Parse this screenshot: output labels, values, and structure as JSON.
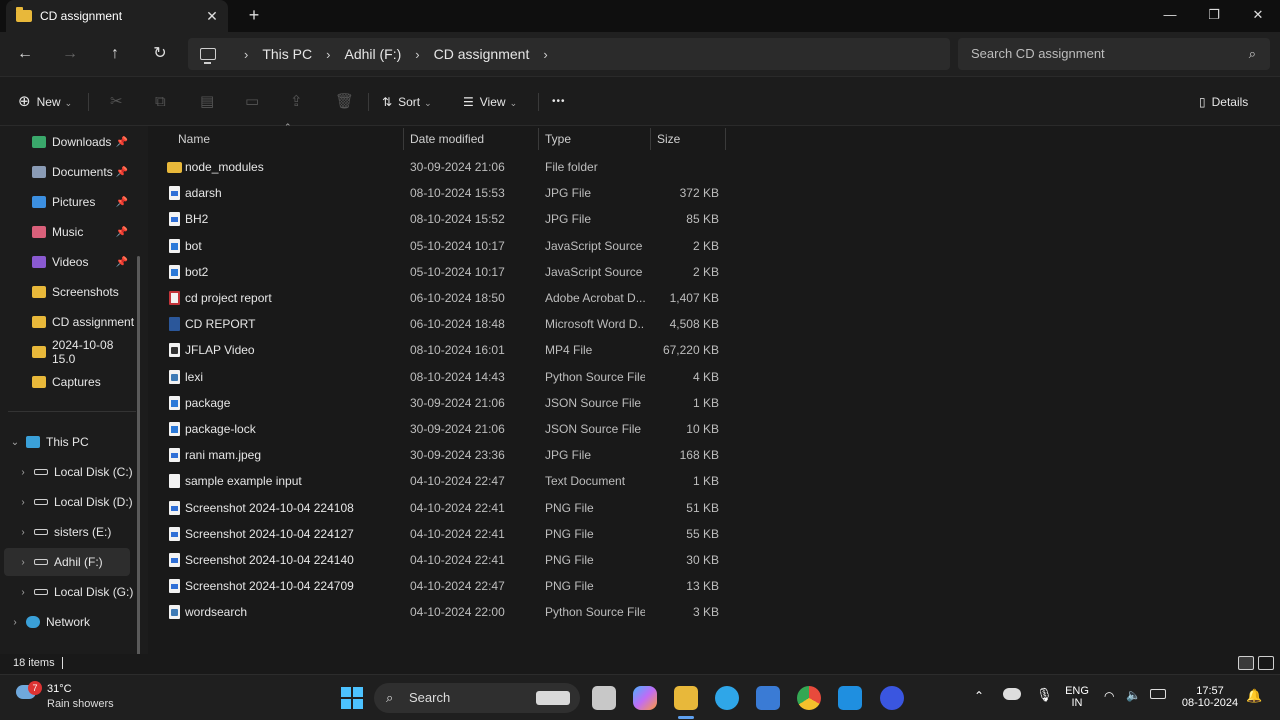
{
  "window": {
    "tab_title": "CD assignment",
    "new_tab_label": "+",
    "minimize": "—",
    "maximize": "❐",
    "close": "✕"
  },
  "nav": {
    "breadcrumb": [
      "This PC",
      "Adhil (F:)",
      "CD assignment"
    ],
    "search_placeholder": "Search CD assignment"
  },
  "toolbar": {
    "new_label": "New",
    "sort_label": "Sort",
    "view_label": "View",
    "more_label": "•••",
    "details_label": "Details"
  },
  "sidebar": {
    "quick_access": [
      {
        "label": "Downloads",
        "icon": "download-icon",
        "color": "#3aa86b",
        "pinned": true
      },
      {
        "label": "Documents",
        "icon": "documents-icon",
        "color": "#8a9bb5",
        "pinned": true
      },
      {
        "label": "Pictures",
        "icon": "pictures-icon",
        "color": "#3c8fe0",
        "pinned": true
      },
      {
        "label": "Music",
        "icon": "music-icon",
        "color": "#d9607a",
        "pinned": true
      },
      {
        "label": "Videos",
        "icon": "videos-icon",
        "color": "#8a5ad1",
        "pinned": true
      },
      {
        "label": "Screenshots",
        "icon": "folder-icon",
        "color": "#e8b83a",
        "pinned": false
      },
      {
        "label": "CD assignment",
        "icon": "folder-icon",
        "color": "#e8b83a",
        "pinned": false
      },
      {
        "label": "2024-10-08 15.0",
        "icon": "folder-icon",
        "color": "#e8b83a",
        "pinned": false
      },
      {
        "label": "Captures",
        "icon": "folder-icon",
        "color": "#e8b83a",
        "pinned": false
      }
    ],
    "this_pc_label": "This PC",
    "drives": [
      {
        "label": "Local Disk (C:)",
        "selected": false
      },
      {
        "label": "Local Disk (D:)",
        "selected": false
      },
      {
        "label": "sisters (E:)",
        "selected": false
      },
      {
        "label": "Adhil (F:)",
        "selected": true
      },
      {
        "label": "Local Disk (G:)",
        "selected": false
      }
    ],
    "network_label": "Network"
  },
  "columns": {
    "name": "Name",
    "date": "Date modified",
    "type": "Type",
    "size": "Size"
  },
  "files": [
    {
      "name": "node_modules",
      "date": "30-09-2024 21:06",
      "type": "File folder",
      "size": "",
      "icon": "folder"
    },
    {
      "name": "adarsh",
      "date": "08-10-2024 15:53",
      "type": "JPG File",
      "size": "372 KB",
      "icon": "img"
    },
    {
      "name": "BH2",
      "date": "08-10-2024 15:52",
      "type": "JPG File",
      "size": "85 KB",
      "icon": "img"
    },
    {
      "name": "bot",
      "date": "05-10-2024 10:17",
      "type": "JavaScript Source ...",
      "size": "2 KB",
      "icon": "js"
    },
    {
      "name": "bot2",
      "date": "05-10-2024 10:17",
      "type": "JavaScript Source ...",
      "size": "2 KB",
      "icon": "js"
    },
    {
      "name": "cd project report",
      "date": "06-10-2024 18:50",
      "type": "Adobe Acrobat D...",
      "size": "1,407 KB",
      "icon": "pdf"
    },
    {
      "name": "CD REPORT",
      "date": "06-10-2024 18:48",
      "type": "Microsoft Word D...",
      "size": "4,508 KB",
      "icon": "word"
    },
    {
      "name": "JFLAP Video",
      "date": "08-10-2024 16:01",
      "type": "MP4 File",
      "size": "67,220 KB",
      "icon": "mp4"
    },
    {
      "name": "lexi",
      "date": "08-10-2024 14:43",
      "type": "Python Source File",
      "size": "4 KB",
      "icon": "py"
    },
    {
      "name": "package",
      "date": "30-09-2024 21:06",
      "type": "JSON Source File",
      "size": "1 KB",
      "icon": "js"
    },
    {
      "name": "package-lock",
      "date": "30-09-2024 21:06",
      "type": "JSON Source File",
      "size": "10 KB",
      "icon": "js"
    },
    {
      "name": "rani mam.jpeg",
      "date": "30-09-2024 23:36",
      "type": "JPG File",
      "size": "168 KB",
      "icon": "img"
    },
    {
      "name": "sample example input",
      "date": "04-10-2024 22:47",
      "type": "Text Document",
      "size": "1 KB",
      "icon": "txt"
    },
    {
      "name": "Screenshot 2024-10-04 224108",
      "date": "04-10-2024 22:41",
      "type": "PNG File",
      "size": "51 KB",
      "icon": "img"
    },
    {
      "name": "Screenshot 2024-10-04 224127",
      "date": "04-10-2024 22:41",
      "type": "PNG File",
      "size": "55 KB",
      "icon": "img"
    },
    {
      "name": "Screenshot 2024-10-04 224140",
      "date": "04-10-2024 22:41",
      "type": "PNG File",
      "size": "30 KB",
      "icon": "img"
    },
    {
      "name": "Screenshot 2024-10-04 224709",
      "date": "04-10-2024 22:47",
      "type": "PNG File",
      "size": "13 KB",
      "icon": "img"
    },
    {
      "name": "wordsearch",
      "date": "04-10-2024 22:00",
      "type": "Python Source File",
      "size": "3 KB",
      "icon": "py"
    }
  ],
  "status": {
    "items_count": "18 items"
  },
  "taskbar": {
    "weather_badge": "7",
    "temperature": "31°C",
    "condition": "Rain showers",
    "search_label": "Search",
    "apps": [
      {
        "name": "start-button",
        "color": "#4cc2ff"
      },
      {
        "name": "task-view",
        "color": "#d0d0d0"
      },
      {
        "name": "copilot",
        "color": "#c06cf5"
      },
      {
        "name": "file-explorer",
        "color": "#e8b83a"
      },
      {
        "name": "edge",
        "color": "#2fa6e8"
      },
      {
        "name": "store",
        "color": "#3a7bd5"
      },
      {
        "name": "chrome",
        "color": "#e84a3c"
      },
      {
        "name": "vscode",
        "color": "#1f8fe0"
      },
      {
        "name": "zoom",
        "color": "#3a56e0"
      }
    ],
    "lang_line1": "ENG",
    "lang_line2": "IN",
    "time": "17:57",
    "date": "08-10-2024"
  }
}
